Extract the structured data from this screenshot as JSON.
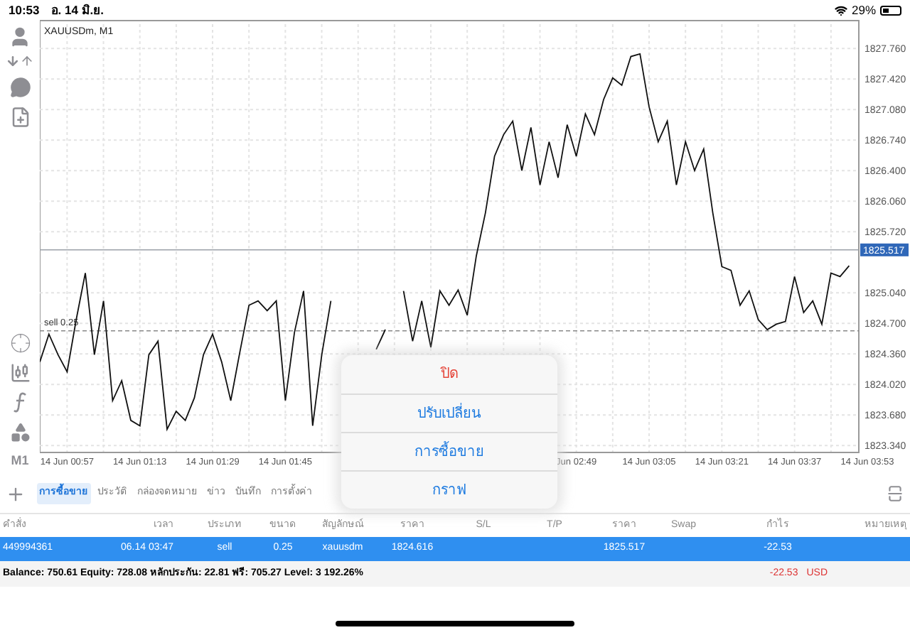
{
  "status_bar": {
    "time": "10:53",
    "date": "อ. 14 มิ.ย.",
    "battery": "29%"
  },
  "toolbar": {
    "timeframe": "M1"
  },
  "chart": {
    "title": "XAUUSDm, M1",
    "chart_data": {
      "type": "line",
      "grid": true,
      "categories": [
        null,
        null,
        null,
        "14 Jun 00:57",
        null,
        null,
        null,
        null,
        null,
        null,
        null,
        "14 Jun 01:13",
        null,
        null,
        null,
        null,
        null,
        null,
        null,
        "14 Jun 01:29",
        null,
        null,
        null,
        null,
        null,
        null,
        null,
        "14 Jun 01:45",
        null,
        null,
        null,
        null,
        null,
        null,
        null,
        null,
        null,
        null,
        null,
        null,
        null,
        null,
        null,
        null,
        null,
        null,
        null,
        null,
        null,
        null,
        null,
        null,
        null,
        null,
        null,
        null,
        null,
        null,
        null,
        "Jun 02:49",
        null,
        null,
        null,
        null,
        null,
        null,
        null,
        "14 Jun 03:05",
        null,
        null,
        null,
        null,
        null,
        null,
        null,
        "14 Jun 03:21",
        null,
        null,
        null,
        null,
        null,
        null,
        null,
        "14 Jun 03:37",
        null,
        null,
        null,
        null,
        null,
        null,
        null,
        "14 Jun 03:53"
      ],
      "ylim": [
        1823.27,
        1828.03
      ],
      "ref_lines": [
        {
          "axis": "y",
          "value": 1825.517,
          "label": "1825.517"
        },
        {
          "axis": "y",
          "value": 1824.616,
          "label": "sell 0.25"
        }
      ],
      "yticks": [
        {
          "value": 1827.76,
          "label": "1827.760"
        },
        {
          "value": 1827.42,
          "label": "1827.420"
        },
        {
          "value": 1827.08,
          "label": "1827.080"
        },
        {
          "value": 1826.74,
          "label": "1826.740"
        },
        {
          "value": 1826.4,
          "label": "1826.400"
        },
        {
          "value": 1826.06,
          "label": "1826.060"
        },
        {
          "value": 1825.72,
          "label": "1825.720"
        },
        {
          "value": 1825.04,
          "label": "1825.040"
        },
        {
          "value": 1824.7,
          "label": "1824.700"
        },
        {
          "value": 1824.36,
          "label": "1824.360"
        },
        {
          "value": 1824.02,
          "label": "1824.020"
        },
        {
          "value": 1823.68,
          "label": "1823.680"
        },
        {
          "value": 1823.34,
          "label": "1823.340"
        }
      ],
      "series": [
        {
          "color": "#111111",
          "values": [
            1824.27,
            1824.58,
            1824.35,
            1824.16,
            1824.74,
            1825.26,
            1824.35,
            1824.95,
            1823.84,
            1824.06,
            1823.62,
            1823.56,
            1824.35,
            1824.5,
            1823.52,
            1823.72,
            1823.62,
            1823.87,
            1824.35,
            1824.58,
            1824.27,
            1823.84,
            1824.38,
            1824.9,
            1824.95,
            1824.84,
            1824.95,
            1823.84,
            1824.6,
            1825.06,
            1823.56,
            1824.35,
            1824.95,
            null,
            null,
            null,
            null,
            1824.41,
            1824.63,
            null,
            1825.06,
            1824.5,
            1824.95,
            1824.43,
            1825.06,
            1824.9,
            1825.07,
            1824.79,
            1825.45,
            1825.93,
            1826.56,
            1826.8,
            1826.95,
            1826.4,
            1826.88,
            1826.24,
            1826.72,
            1826.32,
            1826.91,
            1826.56,
            1827.03,
            1826.8,
            1827.19,
            1827.43,
            1827.35,
            1827.67,
            1827.7,
            1827.11,
            1826.72,
            1826.95,
            1826.24,
            1826.72,
            1826.4,
            1826.64,
            1825.93,
            1825.33,
            1825.29,
            1824.9,
            1825.06,
            1824.74,
            1824.63,
            1824.69,
            1824.72,
            1825.22,
            1824.82,
            1824.95,
            1824.69,
            1825.26,
            1825.22,
            1825.34,
            null,
            null
          ]
        }
      ]
    }
  },
  "popup": {
    "items": [
      {
        "label": "ปิด",
        "kind": "destructive"
      },
      {
        "label": "ปรับเปลี่ยน",
        "kind": "action"
      },
      {
        "label": "การซื้อขาย",
        "kind": "action"
      },
      {
        "label": "กราฟ",
        "kind": "action"
      }
    ]
  },
  "tabs": [
    {
      "label": "การซื้อขาย",
      "selected": true
    },
    {
      "label": "ประวัติ",
      "selected": false
    },
    {
      "label": "กล่องจดหมาย",
      "selected": false
    },
    {
      "label": "ข่าว",
      "selected": false
    },
    {
      "label": "บันทึก",
      "selected": false
    },
    {
      "label": "การตั้งค่า",
      "selected": false
    }
  ],
  "table": {
    "columns": [
      "คำสั่ง",
      "เวลา",
      "ประเภท",
      "ขนาด",
      "สัญลักษณ์",
      "ราคา",
      "S/L",
      "T/P",
      "ราคา",
      "Swap",
      "กำไร",
      "หมายเหตุ"
    ],
    "rows": [
      {
        "selected": true,
        "cells": [
          "449994361",
          "06.14 03:47",
          "sell",
          "0.25",
          "xauusdm",
          "1824.616",
          "",
          "",
          "1825.517",
          "",
          "-22.53",
          ""
        ]
      }
    ]
  },
  "summary": {
    "text": "Balance: 750.61 Equity: 728.08 หลักประกัน: 22.81 ฟรี: 705.27 Level: 3 192.26%",
    "profit": "-22.53",
    "currency": "USD"
  }
}
